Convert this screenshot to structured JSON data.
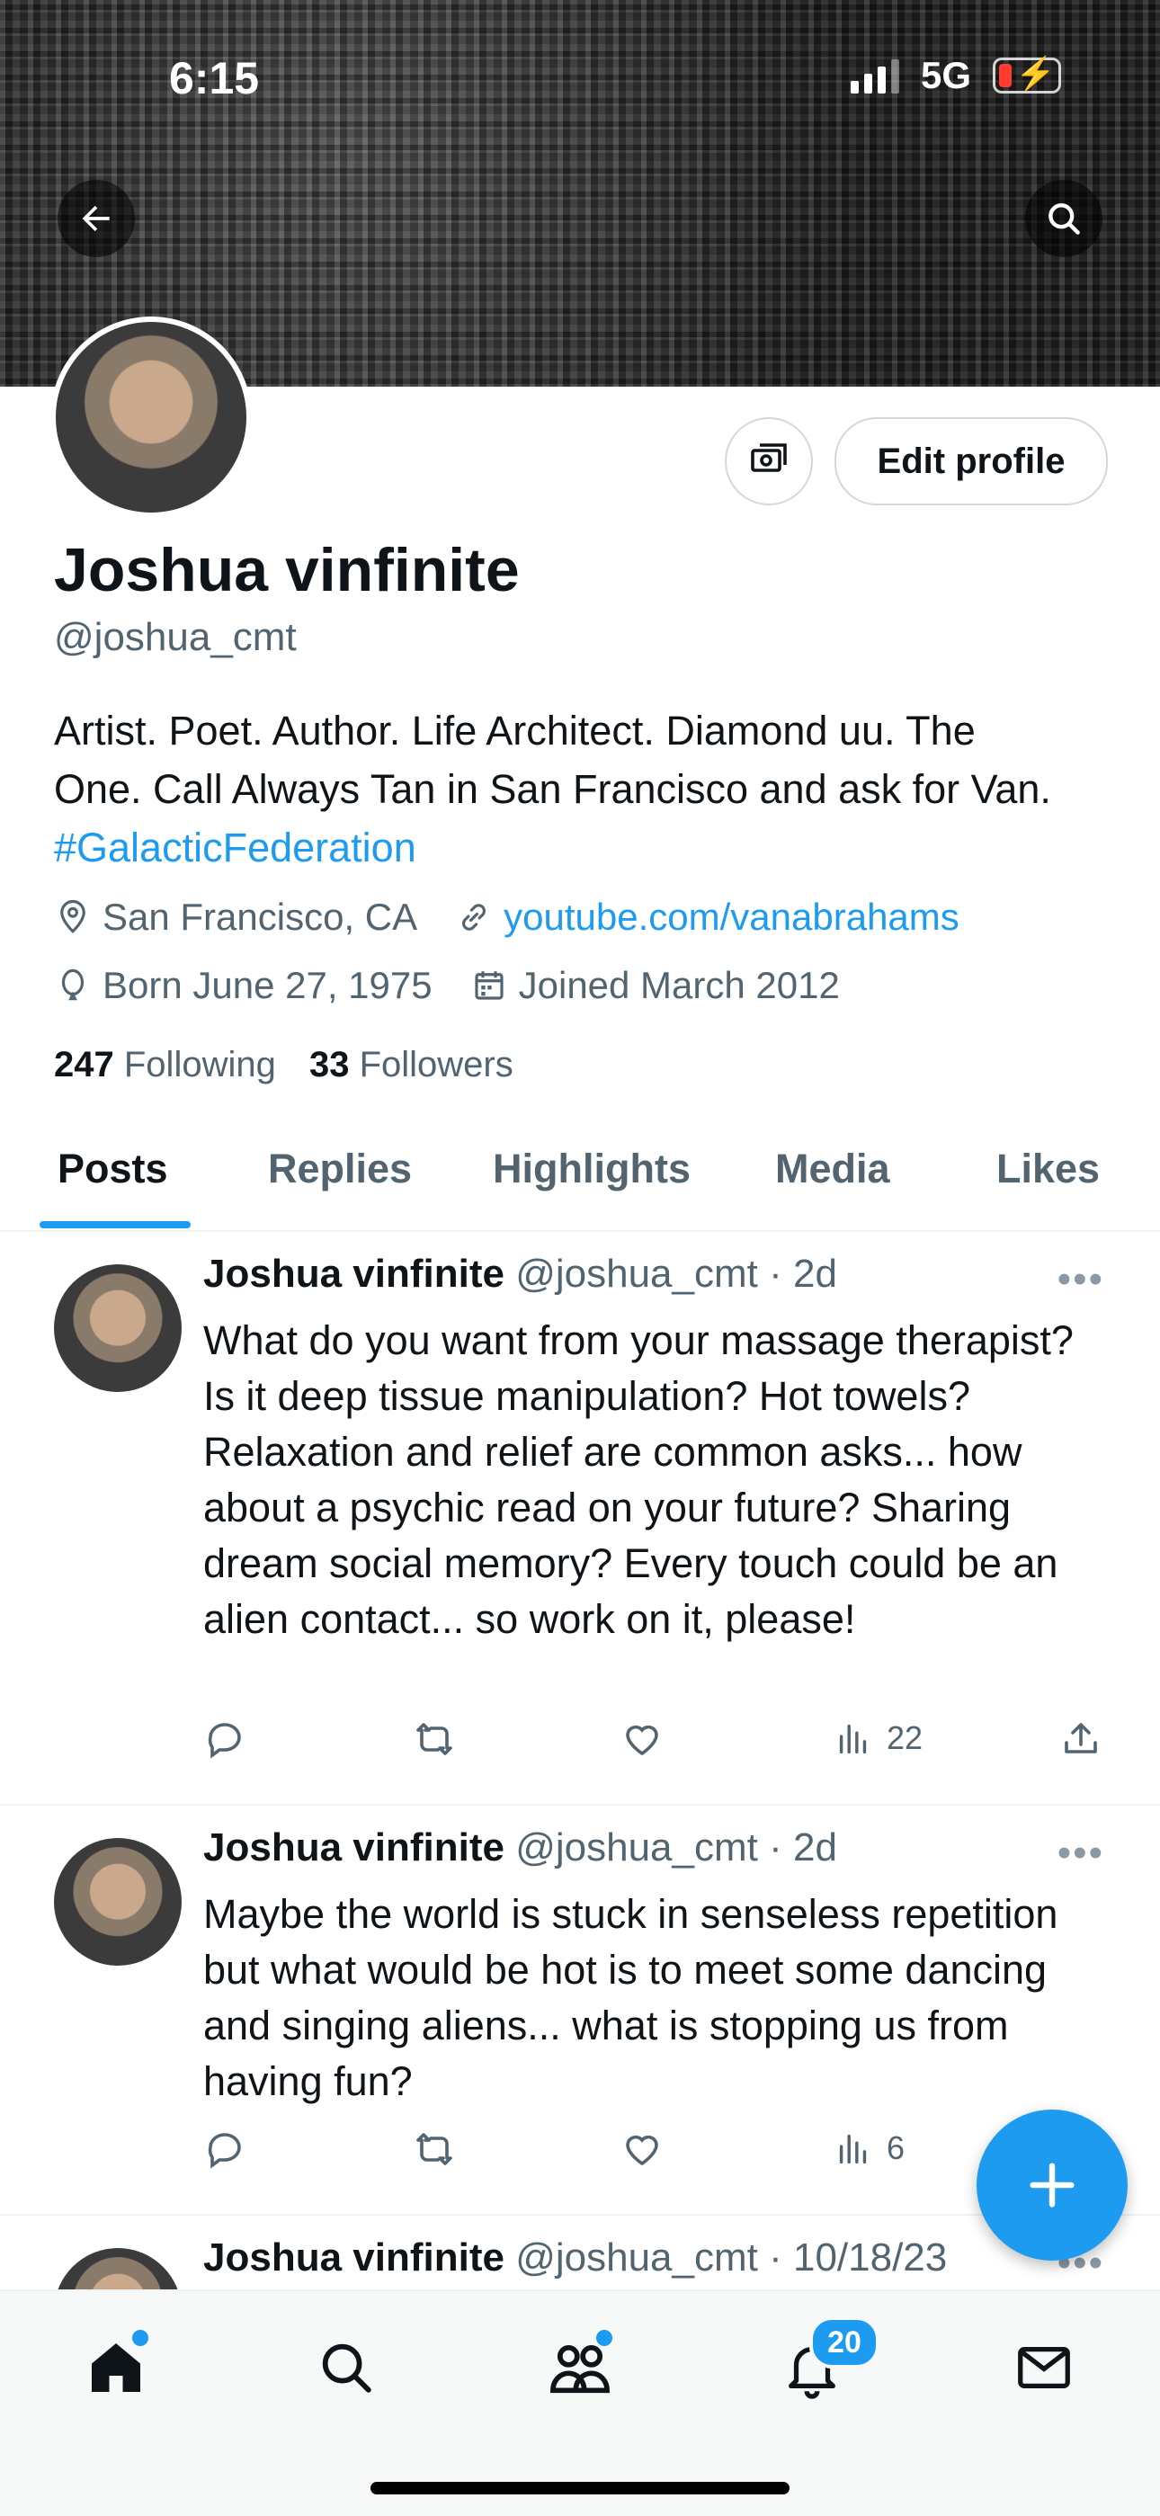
{
  "status_bar": {
    "time": "6:15",
    "network": "5G"
  },
  "profile": {
    "name": "Joshua vinfinite",
    "handle": "@joshua_cmt",
    "edit_button": "Edit profile",
    "bio_lines": [
      "Artist. Poet. Author. Life Architect. Diamond uu. The",
      "One. Call Always Tan in San Francisco and ask for Van."
    ],
    "bio_hashtag": "#GalacticFederation",
    "location": "San Francisco, CA",
    "website": "youtube.com/vanabrahams",
    "birthday": "Born June 27, 1975",
    "joined": "Joined March 2012",
    "following_count": "247",
    "following_label": "Following",
    "followers_count": "33",
    "followers_label": "Followers"
  },
  "tabs": [
    "Posts",
    "Replies",
    "Highlights",
    "Media",
    "Likes"
  ],
  "posts": [
    {
      "name": "Joshua vinfinite",
      "handle": "@joshua_cmt",
      "time": "· 2d",
      "text": "What do you want from your massage therapist?  Is it deep tissue manipulation?  Hot towels?  Relaxation and relief are common asks... how about a psychic read on your future?  Sharing dream social memory?  Every touch could be an alien contact... so work on it, please!",
      "views": "22"
    },
    {
      "name": "Joshua vinfinite",
      "handle": "@joshua_cmt",
      "time": "· 2d",
      "text": "Maybe the world is stuck in senseless repetition but what would be hot is to meet some dancing and singing aliens... what is stopping us from having fun?",
      "views": "6"
    },
    {
      "name": "Joshua vinfinite",
      "handle": "@joshua_cmt",
      "time": "· 10/18/23"
    }
  ],
  "bottom_nav": {
    "notifications_badge": "20"
  },
  "colors": {
    "accent": "#1d9bf0",
    "text": "#0f1419",
    "secondary": "#536471"
  },
  "icons": [
    "back-arrow-icon",
    "search-icon",
    "money-icon",
    "location-icon",
    "link-icon",
    "balloon-icon",
    "calendar-icon",
    "reply-icon",
    "retweet-icon",
    "like-icon",
    "views-icon",
    "share-icon",
    "more-icon",
    "plus-icon",
    "home-icon",
    "communities-icon",
    "bell-icon",
    "mail-icon"
  ]
}
